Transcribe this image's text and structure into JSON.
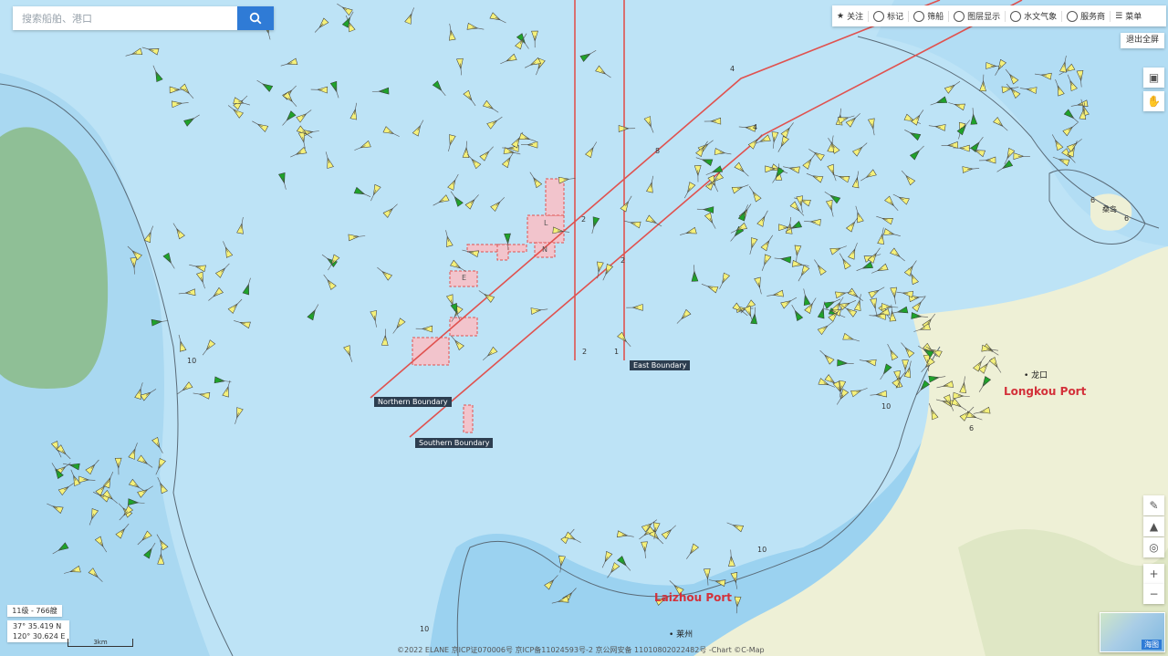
{
  "search": {
    "placeholder": "搜索船舶、港口"
  },
  "toolbar": [
    {
      "label": "关注",
      "icon": "star-icon"
    },
    {
      "label": "标记",
      "icon": "tag-icon"
    },
    {
      "label": "筛船",
      "icon": "filter-icon"
    },
    {
      "label": "图层显示",
      "icon": "layers-icon"
    },
    {
      "label": "水文气象",
      "icon": "weather-icon"
    },
    {
      "label": "服务商",
      "icon": "service-icon"
    },
    {
      "label": "菜单",
      "icon": "menu-icon"
    }
  ],
  "exit_fullscreen": "退出全屏",
  "map": {
    "labels": {
      "northern_boundary": "Northern Boundary",
      "southern_boundary": "Southern Boundary",
      "east_boundary": "East Boundary",
      "longkou_port": "Longkou Port",
      "laizhou_port": "Laizhou Port",
      "longkou_town": "龙口",
      "laizhou_town": "莱州",
      "sangdao": "桑岛"
    },
    "depth_numbers": [
      "2",
      "2",
      "1",
      "2",
      "4",
      "4",
      "6",
      "8",
      "10",
      "10",
      "10",
      "10",
      "6",
      "6"
    ],
    "zone_letters": [
      "L",
      "N",
      "E"
    ]
  },
  "status": {
    "zoom": "11级 - 766艘",
    "lat": "37° 35.419 N",
    "lon": "120° 30.624 E",
    "scale": "3km"
  },
  "footer": "©2022 ELANE  京ICP证070006号  京ICP备11024593号-2  京公网安备 11010802022482号  -Chart ©C-Map",
  "minimap_label": "海图",
  "colors": {
    "sea_deep": "#bde3f6",
    "sea_shallow": "#9bd2f0",
    "land": "#eef0d6",
    "island": "#8fbf96",
    "route_line": "#e0524f",
    "ship_yellow": "#f4f07a",
    "ship_green": "#1fa22a",
    "port_label": "#d3313a"
  }
}
